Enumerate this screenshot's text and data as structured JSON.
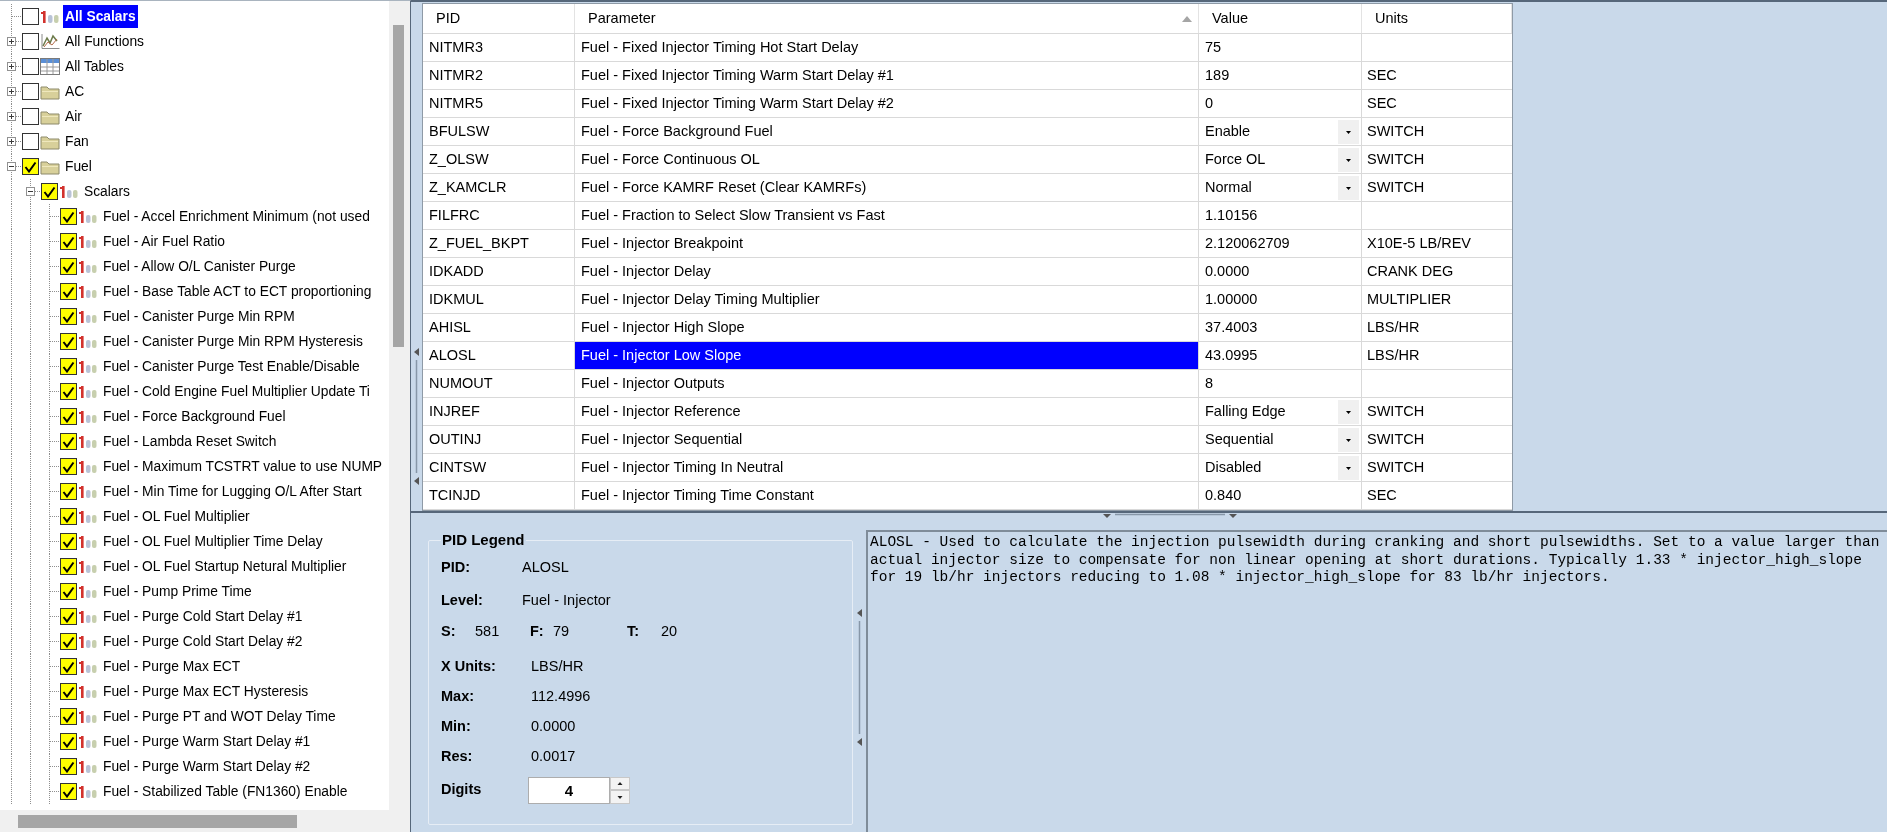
{
  "tree": {
    "items": [
      {
        "label": "All Scalars",
        "kind": "scalars",
        "checked": false,
        "selected": true
      },
      {
        "label": "All Functions",
        "kind": "functions",
        "checked": false,
        "selected": false,
        "expanded": false
      },
      {
        "label": "All Tables",
        "kind": "tables",
        "checked": false,
        "selected": false,
        "expanded": false
      },
      {
        "label": "AC",
        "kind": "folder",
        "checked": false,
        "selected": false,
        "expanded": false
      },
      {
        "label": "Air",
        "kind": "folder",
        "checked": false,
        "selected": false,
        "expanded": false
      },
      {
        "label": "Fan",
        "kind": "folder",
        "checked": false,
        "selected": false,
        "expanded": false
      },
      {
        "label": "Fuel",
        "kind": "folder",
        "checked": true,
        "selected": false,
        "expanded": true,
        "children": [
          {
            "label": "Scalars",
            "kind": "scalars",
            "checked": true,
            "selected": false,
            "expanded": true,
            "children": [
              {
                "label": "Fuel - Accel Enrichment Minimum (not used",
                "kind": "scalar",
                "checked": true,
                "selected": false
              },
              {
                "label": "Fuel - Air Fuel Ratio",
                "kind": "scalar",
                "checked": true,
                "selected": false
              },
              {
                "label": "Fuel - Allow O/L Canister Purge",
                "kind": "scalar",
                "checked": true,
                "selected": false
              },
              {
                "label": "Fuel - Base Table ACT to ECT proportioning",
                "kind": "scalar",
                "checked": true,
                "selected": false
              },
              {
                "label": "Fuel - Canister Purge Min RPM",
                "kind": "scalar",
                "checked": true,
                "selected": false
              },
              {
                "label": "Fuel - Canister Purge Min RPM Hysteresis",
                "kind": "scalar",
                "checked": true,
                "selected": false
              },
              {
                "label": "Fuel - Canister Purge Test Enable/Disable",
                "kind": "scalar",
                "checked": true,
                "selected": false
              },
              {
                "label": "Fuel - Cold Engine Fuel Multiplier Update Ti",
                "kind": "scalar",
                "checked": true,
                "selected": false
              },
              {
                "label": "Fuel - Force Background Fuel",
                "kind": "scalar",
                "checked": true,
                "selected": false
              },
              {
                "label": "Fuel - Lambda Reset Switch",
                "kind": "scalar",
                "checked": true,
                "selected": false
              },
              {
                "label": "Fuel - Maximum TCSTRT value to use NUMP",
                "kind": "scalar",
                "checked": true,
                "selected": false
              },
              {
                "label": "Fuel - Min Time for Lugging O/L After Start",
                "kind": "scalar",
                "checked": true,
                "selected": false
              },
              {
                "label": "Fuel - OL Fuel Multiplier",
                "kind": "scalar",
                "checked": true,
                "selected": false
              },
              {
                "label": "Fuel - OL Fuel Multiplier Time Delay",
                "kind": "scalar",
                "checked": true,
                "selected": false
              },
              {
                "label": "Fuel - OL Fuel Startup Netural Multiplier",
                "kind": "scalar",
                "checked": true,
                "selected": false
              },
              {
                "label": "Fuel - Pump Prime Time",
                "kind": "scalar",
                "checked": true,
                "selected": false
              },
              {
                "label": "Fuel - Purge Cold Start Delay #1",
                "kind": "scalar",
                "checked": true,
                "selected": false
              },
              {
                "label": "Fuel - Purge Cold Start Delay #2",
                "kind": "scalar",
                "checked": true,
                "selected": false
              },
              {
                "label": "Fuel - Purge Max ECT",
                "kind": "scalar",
                "checked": true,
                "selected": false
              },
              {
                "label": "Fuel - Purge Max ECT Hysteresis",
                "kind": "scalar",
                "checked": true,
                "selected": false
              },
              {
                "label": "Fuel - Purge PT and WOT Delay Time",
                "kind": "scalar",
                "checked": true,
                "selected": false
              },
              {
                "label": "Fuel - Purge Warm Start Delay #1",
                "kind": "scalar",
                "checked": true,
                "selected": false
              },
              {
                "label": "Fuel - Purge Warm Start Delay #2",
                "kind": "scalar",
                "checked": true,
                "selected": false
              },
              {
                "label": "Fuel - Stabilized Table (FN1360) Enable",
                "kind": "scalar",
                "checked": true,
                "selected": false
              }
            ]
          }
        ]
      }
    ]
  },
  "table": {
    "columns": [
      {
        "label": "PID",
        "sorted": false
      },
      {
        "label": "Parameter",
        "sorted": true
      },
      {
        "label": "Value",
        "sorted": false
      },
      {
        "label": "Units",
        "sorted": false
      }
    ],
    "rows": [
      {
        "pid": "NITMR3",
        "parameter": "Fuel - Fixed Injector Timing Hot Start Delay",
        "value": "75",
        "kind": "text",
        "selected": false
      },
      {
        "pid": "NITMR2",
        "parameter": "Fuel - Fixed Injector Timing Warm Start Delay #1",
        "value": "189",
        "units": "SEC",
        "kind": "text",
        "selected": false
      },
      {
        "pid": "NITMR5",
        "parameter": "Fuel - Fixed Injector Timing Warm Start Delay #2",
        "value": "0",
        "units": "SEC",
        "kind": "text",
        "selected": false
      },
      {
        "pid": "BFULSW",
        "parameter": "Fuel - Force Background Fuel",
        "value": "Enable",
        "units": "SWITCH",
        "kind": "dropdown",
        "selected": false
      },
      {
        "pid": "Z_OLSW",
        "parameter": "Fuel - Force Continuous OL",
        "value": "Force OL",
        "units": "SWITCH",
        "kind": "dropdown",
        "selected": false
      },
      {
        "pid": "Z_KAMCLR",
        "parameter": "Fuel - Force KAMRF Reset (Clear KAMRFs)",
        "value": "Normal",
        "units": "SWITCH",
        "kind": "dropdown",
        "selected": false
      },
      {
        "pid": "FILFRC",
        "parameter": "Fuel - Fraction to Select Slow Transient vs Fast",
        "value": "1.10156",
        "kind": "text",
        "selected": false
      },
      {
        "pid": "Z_FUEL_BKPT",
        "parameter": "Fuel - Injector Breakpoint",
        "value": "2.120062709",
        "units": "X10E-5 LB/REV",
        "kind": "text",
        "selected": false
      },
      {
        "pid": "IDKADD",
        "parameter": "Fuel - Injector Delay",
        "value": "0.0000",
        "units": "CRANK DEG",
        "kind": "text",
        "selected": false
      },
      {
        "pid": "IDKMUL",
        "parameter": "Fuel - Injector Delay Timing Multiplier",
        "value": "1.00000",
        "units": "MULTIPLIER",
        "kind": "text",
        "selected": false
      },
      {
        "pid": "AHISL",
        "parameter": "Fuel - Injector High Slope",
        "value": "37.4003",
        "units": "LBS/HR",
        "kind": "text",
        "selected": false
      },
      {
        "pid": "ALOSL",
        "parameter": "Fuel - Injector Low Slope",
        "value": "43.0995",
        "units": "LBS/HR",
        "kind": "text",
        "selected": true
      },
      {
        "pid": "NUMOUT",
        "parameter": "Fuel - Injector Outputs",
        "value": "8",
        "kind": "text",
        "selected": false
      },
      {
        "pid": "INJREF",
        "parameter": "Fuel - Injector Reference",
        "value": "Falling Edge",
        "units": "SWITCH",
        "kind": "dropdown",
        "selected": false
      },
      {
        "pid": "OUTINJ",
        "parameter": "Fuel - Injector Sequential",
        "value": "Sequential",
        "units": "SWITCH",
        "kind": "dropdown",
        "selected": false
      },
      {
        "pid": "CINTSW",
        "parameter": "Fuel - Injector Timing In Neutral",
        "value": "Disabled",
        "units": "SWITCH",
        "kind": "dropdown",
        "selected": false
      },
      {
        "pid": "TCINJD",
        "parameter": "Fuel - Injector Timing Time Constant",
        "value": "0.840",
        "units": "SEC",
        "kind": "text",
        "selected": false
      }
    ]
  },
  "legend": {
    "title": "PID Legend",
    "info": [
      {
        "label": "PID:",
        "value": "ALOSL"
      },
      {
        "label": "Level:",
        "value": "Fuel - Injector"
      }
    ],
    "counts": [
      {
        "label": "S:",
        "value": "581"
      },
      {
        "label": "F:",
        "value": "79"
      },
      {
        "label": "T:",
        "value": "20"
      }
    ],
    "details": [
      {
        "label": "X Units:",
        "value": "LBS/HR"
      },
      {
        "label": "Max:",
        "value": "112.4996"
      },
      {
        "label": "Min:",
        "value": "0.0000"
      },
      {
        "label": "Res:",
        "value": "0.0017"
      }
    ],
    "digits": {
      "label": "Digits",
      "value": "4"
    }
  },
  "description": {
    "text": "ALOSL - Used to calculate the injection pulsewidth during cranking and short pulsewidths. Set to a value larger than actual injector size to compensate for non linear opening at short durations. Typically 1.33 * injector_high_slope for 19 lb/hr injectors reducing to 1.08 * injector_high_slope for 83 lb/hr injectors."
  }
}
